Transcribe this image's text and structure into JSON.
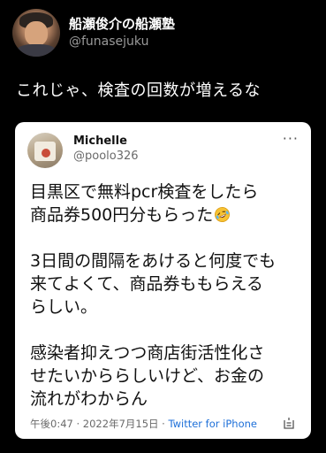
{
  "outer_tweet": {
    "display_name": "船瀬俊介の船瀬塾",
    "handle": "@funasejuku",
    "text": "これじゃ、検査の回数が増えるな"
  },
  "quoted_tweet": {
    "display_name": "Michelle",
    "handle": "@poolo326",
    "paragraph_1_line_1": "目黒区で無料pcr検査をしたら",
    "paragraph_1_line_2": "商品券500円分もらった",
    "emoji_icon": "rolling-on-floor-laughing-emoji",
    "paragraph_2_line_1": "3日間の間隔をあけると何度でも",
    "paragraph_2_line_2": "来てよくて、商品券ももらえる",
    "paragraph_2_line_3": "らしい。",
    "paragraph_3_line_1": "感染者抑えつつ商店街活性化さ",
    "paragraph_3_line_2": "せたいかららしいけど、お金の",
    "paragraph_3_line_3": "流れがわからん",
    "time": "午後0:47",
    "separator": " · ",
    "date": "2022年7月15日",
    "source": "Twitter for iPhone",
    "more_icon": "more-dots-icon",
    "share_icon": "share-icon"
  },
  "colors": {
    "background": "#000000",
    "card_background": "#ffffff",
    "handle_gray": "#9a9a9a",
    "link_blue": "#1d6fd8"
  }
}
